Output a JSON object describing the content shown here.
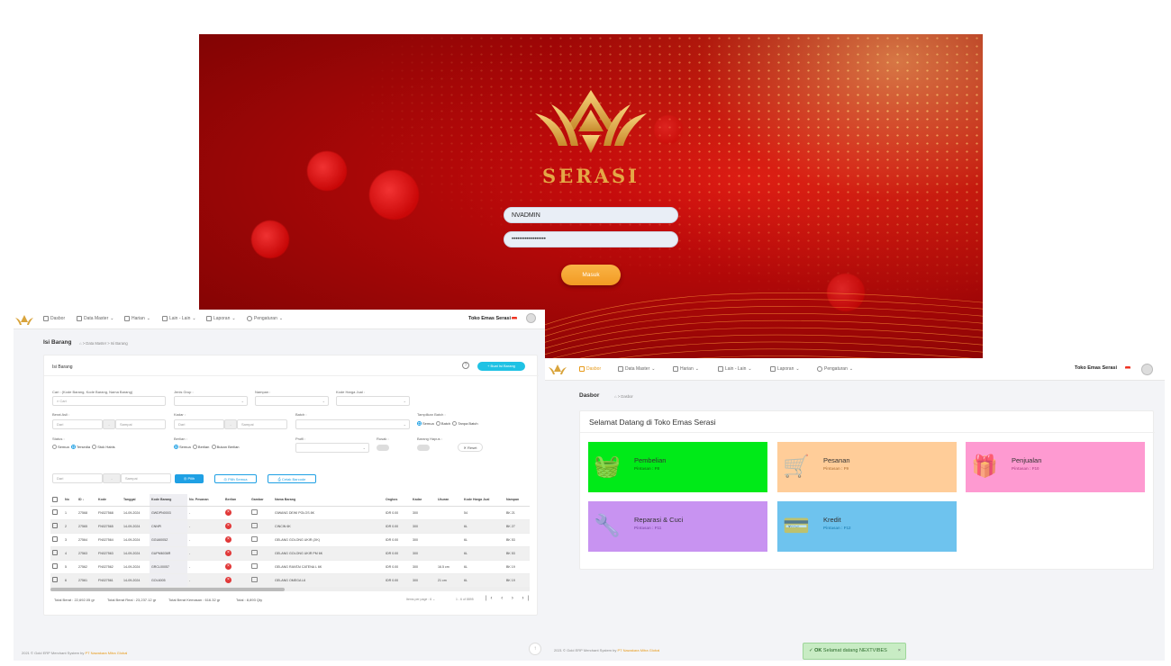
{
  "login": {
    "brand": "SERASI",
    "username_value": "NVADMIN",
    "password_value": "••••••••••••••••••",
    "submit_label": "Masuk"
  },
  "colors": {
    "accent": "#1fc2e4",
    "login_button": "#f29a23",
    "brand_gold": "#e4a846",
    "pembelian": "#00ea18",
    "pesanan": "#ffcd99",
    "penjualan": "#fe9ad1",
    "reparasi": "#c893f1",
    "kredit": "#6ec3ee"
  },
  "nav": {
    "items": [
      "Dasbor",
      "Data Master",
      "Harian",
      "Lain - Lain",
      "Laporan",
      "Pengaturan"
    ],
    "shop_name": "Toko Emas Serasi"
  },
  "stock": {
    "page_title": "Isi Barang",
    "breadcrumb": "> Data Master > Isi Barang",
    "card_title": "Isi Barang",
    "add_button": "+ Buat Isi Barang",
    "filters": {
      "search_label": "Cari : (Kode Barang, Kode Barang, Nama Barang)",
      "search_placeholder": "Cari",
      "jenis_grup_label": "Jenis Grup :",
      "nampan_label": "Nampan :",
      "kode_harga_label": "Kode Harga Jual :",
      "berat_asli_label": "Berat Asli :",
      "kadar_label": "Kadar :",
      "batch_label": "Batch :",
      "tampilkan_batch_label": "Tampilkan Batch :",
      "dari": "Dari",
      "sampai": "Sampai",
      "tampilkan_batch_options": [
        "Semua",
        "Batch",
        "Tanpa Batch"
      ],
      "status_label": "Status :",
      "status_options": [
        "Semua",
        "Tersedia",
        "Stok Habis"
      ],
      "berlian_label": "Berlian :",
      "berlian_options": [
        "Semua",
        "Berlian",
        "Bukan Berlian"
      ],
      "profil_label": "Profil :",
      "rusak_label": "Rusak :",
      "barang_hapus_label": "Barang Hapus :",
      "reset": "Reset",
      "pilih": "Pilih",
      "pilih_semua": "Pilih Semua",
      "cetak_barcode": "Cetak Barcode"
    },
    "table": {
      "headers": [
        "No",
        "ID",
        "Kode",
        "Tanggal",
        "Kode Barang",
        "No. Pesanan",
        "Berlian",
        "Gambar",
        "Nama Barang",
        "Ongkos",
        "Kadar",
        "Ukuran",
        "Kode Harga Jual",
        "Nampan"
      ],
      "rows": [
        [
          "1",
          "27568",
          "FN027568",
          "14-09-2024",
          "GWDPN0003",
          "-",
          "",
          "",
          "GIWANG DEWI POLOS 8K",
          "IDR 0.00",
          "300",
          "",
          "54",
          "BK 21"
        ],
        [
          "2",
          "27565",
          "FN027565",
          "14-09-2024",
          "CNNPI",
          "-",
          "",
          "",
          "CINCIN 6K",
          "IDR 0.00",
          "300",
          "",
          "6L",
          "BK 27"
        ],
        [
          "3",
          "27564",
          "FN027564",
          "14-09-2024",
          "GGU6005Z",
          "-",
          "",
          "",
          "GELANG GOLONG UKIR (JIK)",
          "IDR 0.00",
          "300",
          "",
          "6L",
          "BK 53"
        ],
        [
          "4",
          "27563",
          "FN027563",
          "14-09-2024",
          "GUPM6036R",
          "-",
          "",
          "",
          "GELANG GOLONG UKIR PM 6K",
          "IDR 0.00",
          "300",
          "",
          "6L",
          "BK 53"
        ],
        [
          "5",
          "27562",
          "FN027562",
          "14-09-2024",
          "GRCL00057",
          "-",
          "",
          "",
          "GELANG RANTAI CATENA L 6K",
          "IDR 0.00",
          "300",
          "16.5 cm",
          "6L",
          "BK 19"
        ],
        [
          "6",
          "27561",
          "FN027561",
          "14-09-2024",
          "GOL6005",
          "-",
          "",
          "",
          "GELANG OMEGA L6",
          "IDR 0.00",
          "300",
          "21 cm",
          "6L",
          "BK 19"
        ]
      ]
    },
    "totals": {
      "berat": "Total Berat : 22,692.05 gr",
      "berat_real": "Total Berat Real : 23,237.12 gr",
      "berat_kemasan": "Total Berat Kemasan : 616.32 gr",
      "total": "Total : 8,893 Qty"
    },
    "pagination": {
      "items_per_page": "Items per page : 6",
      "range": "1 - 6 of 8895"
    },
    "copyright": "2021 © Gold ERP Merchant System by",
    "company": "PT Nawakara Mitra Global"
  },
  "dash": {
    "page_title": "Dasbor",
    "breadcrumb": "> Dasbor",
    "welcome": "Selamat Datang di Toko Emas Serasi",
    "tiles": [
      {
        "title": "Pembelian",
        "shortcut": "Pintasan : F8",
        "color": "#00ea18",
        "shortcut_color": "#0b8a12"
      },
      {
        "title": "Pesanan",
        "shortcut": "Pintasan : F9",
        "color": "#ffcd99",
        "shortcut_color": "#c2874d"
      },
      {
        "title": "Penjualan",
        "shortcut": "Pintasan : F10",
        "color": "#fe9ad1",
        "shortcut_color": "#c05596"
      },
      {
        "title": "Reparasi & Cuci",
        "shortcut": "Pintasan : F11",
        "color": "#c893f1",
        "shortcut_color": "#8c56b6"
      },
      {
        "title": "Kredit",
        "shortcut": "Pintasan : F12",
        "color": "#6ec3ee",
        "shortcut_color": "#2b8bbd"
      }
    ],
    "copyright": "2021 © Gold ERP Merchant System by",
    "company": "PT Nawakara Mitra Global"
  },
  "toast": {
    "ok": "OK",
    "message": "Selamat datang NEXTVIBES",
    "close": "×"
  }
}
